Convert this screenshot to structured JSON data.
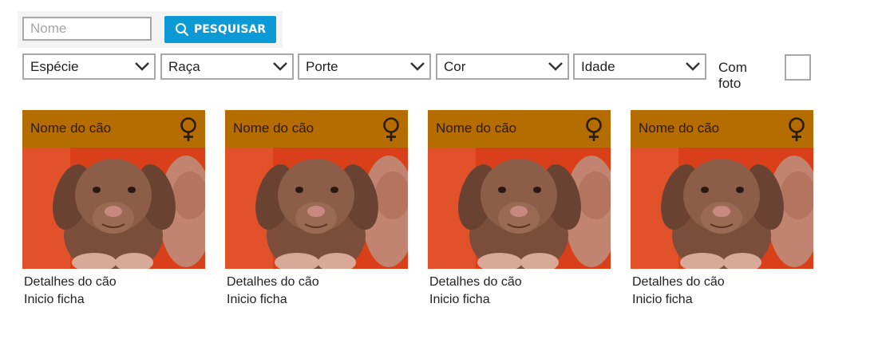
{
  "search": {
    "placeholder": "Nome",
    "button_label": "PESQUISAR",
    "button_color": "#0c9ad6"
  },
  "filters": {
    "especie": "Espécie",
    "raca": "Raça",
    "porte": "Porte",
    "cor": "Cor",
    "idade": "Idade",
    "com_foto_label": "Com foto"
  },
  "cards": [
    {
      "name": "Nome do cão",
      "details": "Detalhes do cão",
      "start": "Inicio ficha",
      "gender_icon": "female-icon"
    },
    {
      "name": "Nome do cão",
      "details": "Detalhes do cão",
      "start": "Inicio ficha",
      "gender_icon": "female-icon"
    },
    {
      "name": "Nome do cão",
      "details": "Detalhes do cão",
      "start": "Inicio ficha",
      "gender_icon": "female-icon"
    },
    {
      "name": "Nome do cão",
      "details": "Detalhes do cão",
      "start": "Inicio ficha",
      "gender_icon": "female-icon"
    }
  ],
  "colors": {
    "card_header": "#b56c00",
    "photo_background": "#d9401a"
  }
}
